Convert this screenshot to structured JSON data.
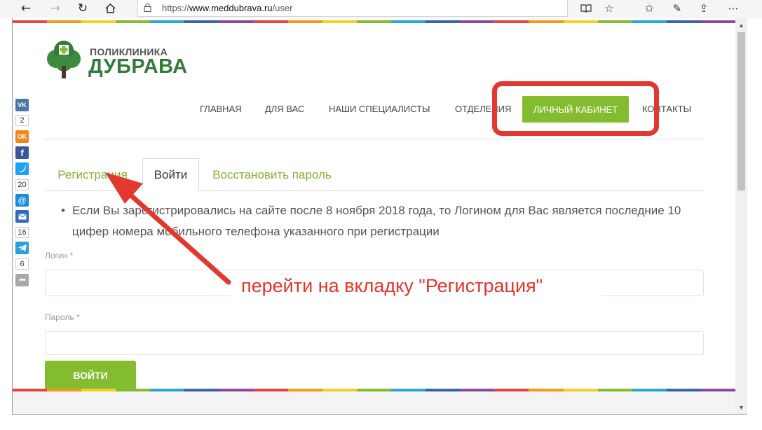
{
  "browser": {
    "url_prefix": "https://",
    "url_host": "www.meddubrava.ru",
    "url_path": "/user"
  },
  "logo": {
    "small": "ПОЛИКЛИНИКА",
    "big": "ДУБРАВА"
  },
  "menu": {
    "items": [
      "ГЛАВНАЯ",
      "ДЛЯ ВАС",
      "НАШИ СПЕЦИАЛИСТЫ",
      "ОТДЕЛЕНИЯ"
    ],
    "cta": "ЛИЧНЫЙ КАБИНЕТ",
    "contacts": "КОНТАКТЫ"
  },
  "tabs": {
    "register": "Регистрация",
    "login": "Войти",
    "restore": "Восстановить пароль"
  },
  "info": {
    "bullet": "•",
    "text": "Если Вы зарегистрировались на сайте после 8 ноября 2018 года, то Логином для Вас является последние 10 цифер номера мобильного телефона указанного при регистрации"
  },
  "form": {
    "login_label": "Логин *",
    "password_label": "Пароль *",
    "submit": "ВОЙТИ"
  },
  "share": {
    "counts": [
      "2",
      "20",
      "16",
      "6"
    ]
  },
  "annotation": {
    "text": "перейти на вкладку \"Регистрация\""
  },
  "colors": {
    "brand_green": "#83bd2f",
    "logo_green": "#357a3a",
    "annotation_red": "#e3382f"
  }
}
